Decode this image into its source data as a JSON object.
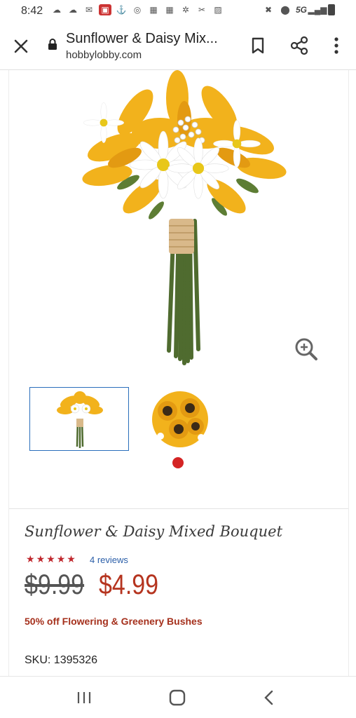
{
  "status": {
    "time": "8:42",
    "network": "5G"
  },
  "toolbar": {
    "title": "Sunflower & Daisy Mix...",
    "url": "hobbylobby.com"
  },
  "product": {
    "name": "Sunflower & Daisy Mixed Bouquet",
    "rating_stars": 5,
    "reviews": "4 reviews",
    "old_price": "$9.99",
    "new_price": "$4.99",
    "promo": "50% off Flowering & Greenery Bushes",
    "sku": "SKU: 1395326"
  },
  "colors": {
    "price": "#b5341f",
    "star": "#c0272d",
    "link": "#2a5ea8",
    "thumb_border": "#2a6ebb",
    "carousel_dot": "#d42424"
  }
}
